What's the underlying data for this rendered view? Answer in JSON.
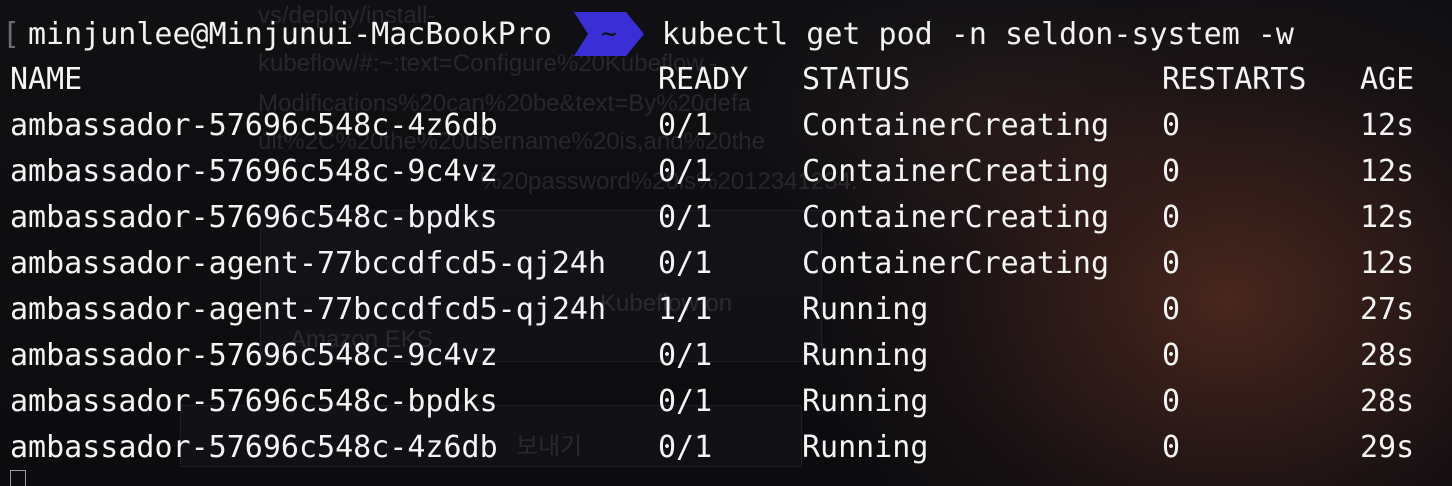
{
  "terminal": {
    "prompt": {
      "open_bracket": "[",
      "user_host": "minjunlee@Minjunui-MacBookPro",
      "path": "~",
      "command": "kubectl get pod -n seldon-system -w"
    },
    "headers": {
      "name": "NAME",
      "ready": "READY",
      "status": "STATUS",
      "restarts": "RESTARTS",
      "age": "AGE"
    },
    "rows": [
      {
        "name": "ambassador-57696c548c-4z6db",
        "ready": "0/1",
        "status": "ContainerCreating",
        "restarts": "0",
        "age": "12s"
      },
      {
        "name": "ambassador-57696c548c-9c4vz",
        "ready": "0/1",
        "status": "ContainerCreating",
        "restarts": "0",
        "age": "12s"
      },
      {
        "name": "ambassador-57696c548c-bpdks",
        "ready": "0/1",
        "status": "ContainerCreating",
        "restarts": "0",
        "age": "12s"
      },
      {
        "name": "ambassador-agent-77bccdfcd5-qj24h",
        "ready": "0/1",
        "status": "ContainerCreating",
        "restarts": "0",
        "age": "12s"
      },
      {
        "name": "ambassador-agent-77bccdfcd5-qj24h",
        "ready": "1/1",
        "status": "Running",
        "restarts": "0",
        "age": "27s"
      },
      {
        "name": "ambassador-57696c548c-9c4vz",
        "ready": "0/1",
        "status": "Running",
        "restarts": "0",
        "age": "28s"
      },
      {
        "name": "ambassador-57696c548c-bpdks",
        "ready": "0/1",
        "status": "Running",
        "restarts": "0",
        "age": "28s"
      },
      {
        "name": "ambassador-57696c548c-4z6db",
        "ready": "0/1",
        "status": "Running",
        "restarts": "0",
        "age": "29s"
      }
    ]
  },
  "background": {
    "ghost_lines": [
      "vs/deploy/install-",
      "kubeflow/#:~:text=Configure%20Kubeflow,-",
      "Modifications%20can%20be&text=By%20defa",
      "ult%2C%20the%20username%20is,and%20the",
      "%20password%20is%2012341234.",
      "Kubeflow on",
      "Amazon EKS",
      "보내기"
    ]
  },
  "colors": {
    "segment_bg": "#3a2fd6",
    "text": "#f2f2f2",
    "background": "#0c0c0f"
  }
}
